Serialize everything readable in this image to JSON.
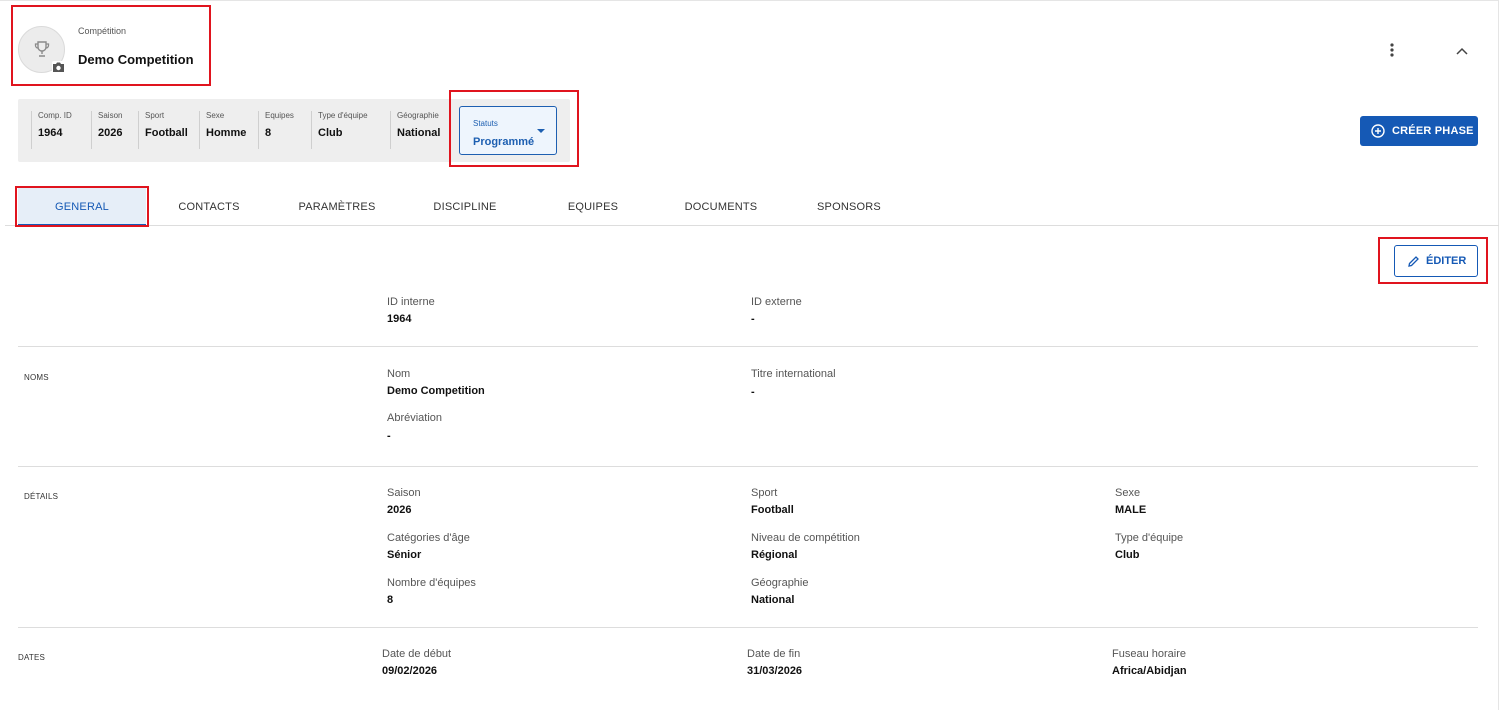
{
  "header": {
    "label": "Compétition",
    "title": "Demo Competition"
  },
  "summary": [
    {
      "label": "Comp. ID",
      "value": "1964"
    },
    {
      "label": "Saison",
      "value": "2026"
    },
    {
      "label": "Sport",
      "value": "Football"
    },
    {
      "label": "Sexe",
      "value": "Homme"
    },
    {
      "label": "Equipes",
      "value": "8"
    },
    {
      "label": "Type d'équipe",
      "value": "Club"
    },
    {
      "label": "Géographie",
      "value": "National"
    }
  ],
  "status": {
    "label": "Statuts",
    "value": "Programmé"
  },
  "actions": {
    "create_phase": "CRÉER PHASE",
    "edit": "ÉDITER"
  },
  "tabs": [
    "GENERAL",
    "CONTACTS",
    "PARAMÈTRES",
    "DISCIPLINE",
    "EQUIPES",
    "DOCUMENTS",
    "SPONSORS"
  ],
  "active_tab": "GENERAL",
  "ids": {
    "internal": {
      "label": "ID interne",
      "value": "1964"
    },
    "external": {
      "label": "ID externe",
      "value": "-"
    }
  },
  "noms": {
    "section": "NOMS",
    "nom": {
      "label": "Nom",
      "value": "Demo Competition"
    },
    "titre_international": {
      "label": "Titre international",
      "value": "-"
    },
    "abreviation": {
      "label": "Abréviation",
      "value": "-"
    }
  },
  "details": {
    "section": "DÉTAILS",
    "saison": {
      "label": "Saison",
      "value": "2026"
    },
    "sport": {
      "label": "Sport",
      "value": "Football"
    },
    "sexe": {
      "label": "Sexe",
      "value": "MALE"
    },
    "categories": {
      "label": "Catégories d'âge",
      "value": "Sénior"
    },
    "niveau": {
      "label": "Niveau de compétition",
      "value": "Régional"
    },
    "type_equipe": {
      "label": "Type d'équipe",
      "value": "Club"
    },
    "nombre_equipes": {
      "label": "Nombre d'équipes",
      "value": "8"
    },
    "geographie": {
      "label": "Géographie",
      "value": "National"
    }
  },
  "dates": {
    "section": "DATES",
    "debut": {
      "label": "Date de début",
      "value": "09/02/2026"
    },
    "fin": {
      "label": "Date de fin",
      "value": "31/03/2026"
    },
    "fuseau": {
      "label": "Fuseau horaire",
      "value": "Africa/Abidjan"
    }
  },
  "colors": {
    "accent": "#1559b5",
    "highlight": "#e0141e"
  },
  "icons": [
    "trophy-icon",
    "camera-icon",
    "more-vertical-icon",
    "chevron-up-icon",
    "plus-circle-icon",
    "pencil-icon",
    "caret-down-icon"
  ]
}
